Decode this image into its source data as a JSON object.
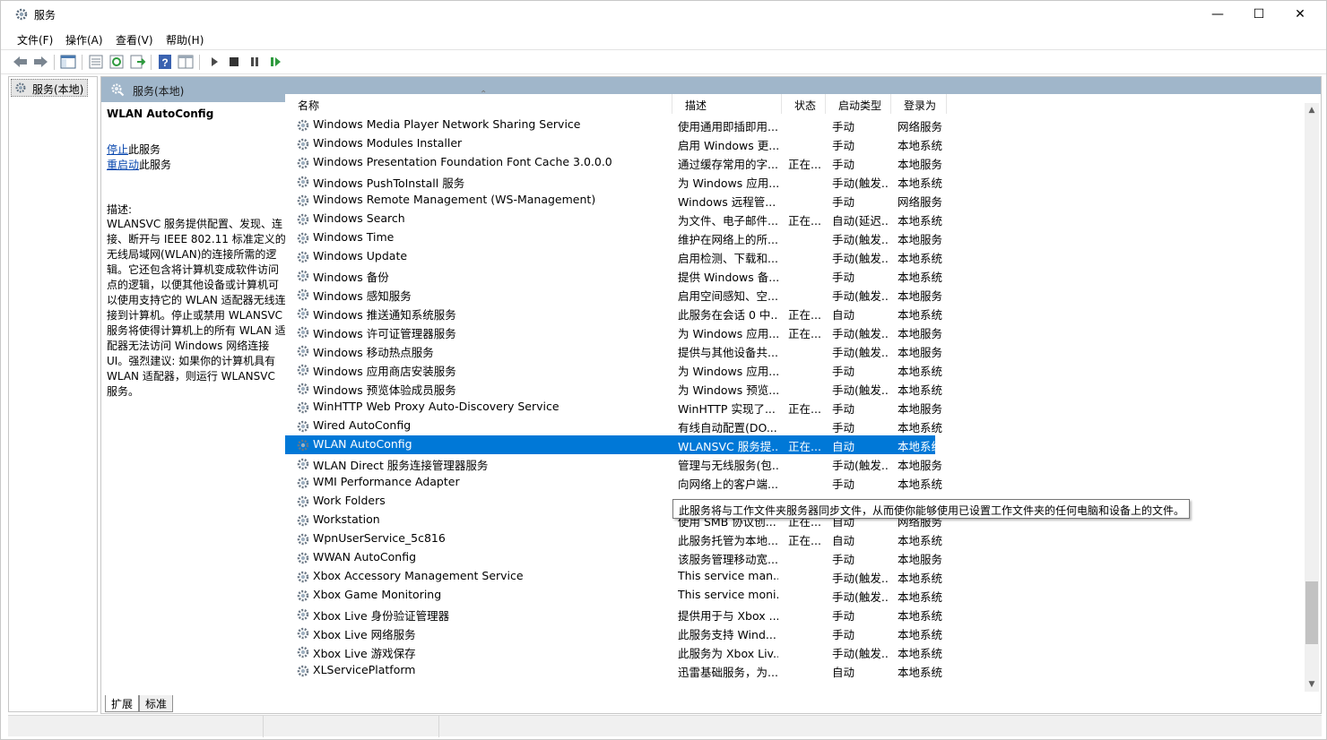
{
  "window": {
    "title": "服务",
    "minimize_label": "—",
    "maximize_label": "☐",
    "close_label": "✕"
  },
  "menu": {
    "items": [
      {
        "label": "文件(F)"
      },
      {
        "label": "操作(A)"
      },
      {
        "label": "查看(V)"
      },
      {
        "label": "帮助(H)"
      }
    ]
  },
  "toolbar": {
    "icons": [
      "back-icon",
      "forward-icon",
      "show-hide-tree-icon",
      "properties-icon",
      "refresh-icon",
      "export-list-icon",
      "help-icon",
      "show-pane-icon",
      "start-service-icon",
      "stop-service-icon",
      "pause-service-icon",
      "restart-service-icon"
    ]
  },
  "tree": {
    "selected_item": "服务(本地)"
  },
  "panel": {
    "header_title": "服务(本地)"
  },
  "description": {
    "service_name": "WLAN AutoConfig",
    "stop_link": "停止",
    "stop_suffix": "此服务",
    "restart_link": "重启动",
    "restart_suffix": "此服务",
    "label": "描述:",
    "text": "WLANSVC 服务提供配置、发现、连接、断开与 IEEE 802.11 标准定义的无线局域网(WLAN)的连接所需的逻辑。它还包含将计算机变成软件访问点的逻辑，以便其他设备或计算机可以使用支持它的 WLAN 适配器无线连接到计算机。停止或禁用 WLANSVC 服务将使得计算机上的所有 WLAN 适配器无法访问 Windows 网络连接 UI。强烈建议: 如果你的计算机具有 WLAN 适配器，则运行 WLANSVC 服务。"
  },
  "columns": {
    "name": "名称",
    "desc": "描述",
    "status": "状态",
    "startup": "启动类型",
    "logon": "登录为"
  },
  "services": [
    {
      "name": "Windows Media Player Network Sharing Service",
      "desc": "使用通用即插即用...",
      "status": "",
      "startup": "手动",
      "logon": "网络服务"
    },
    {
      "name": "Windows Modules Installer",
      "desc": "启用 Windows 更...",
      "status": "",
      "startup": "手动",
      "logon": "本地系统"
    },
    {
      "name": "Windows Presentation Foundation Font Cache 3.0.0.0",
      "desc": "通过缓存常用的字...",
      "status": "正在...",
      "startup": "手动",
      "logon": "本地服务"
    },
    {
      "name": "Windows PushToInstall 服务",
      "desc": "为 Windows 应用...",
      "status": "",
      "startup": "手动(触发...",
      "logon": "本地系统"
    },
    {
      "name": "Windows Remote Management (WS-Management)",
      "desc": "Windows 远程管...",
      "status": "",
      "startup": "手动",
      "logon": "网络服务"
    },
    {
      "name": "Windows Search",
      "desc": "为文件、电子邮件...",
      "status": "正在...",
      "startup": "自动(延迟...",
      "logon": "本地系统"
    },
    {
      "name": "Windows Time",
      "desc": "维护在网络上的所...",
      "status": "",
      "startup": "手动(触发...",
      "logon": "本地服务"
    },
    {
      "name": "Windows Update",
      "desc": "启用检测、下载和...",
      "status": "",
      "startup": "手动(触发...",
      "logon": "本地系统"
    },
    {
      "name": "Windows 备份",
      "desc": "提供 Windows 备...",
      "status": "",
      "startup": "手动",
      "logon": "本地系统"
    },
    {
      "name": "Windows 感知服务",
      "desc": "启用空间感知、空...",
      "status": "",
      "startup": "手动(触发...",
      "logon": "本地服务"
    },
    {
      "name": "Windows 推送通知系统服务",
      "desc": "此服务在会话 0 中...",
      "status": "正在...",
      "startup": "自动",
      "logon": "本地系统"
    },
    {
      "name": "Windows 许可证管理器服务",
      "desc": "为 Windows 应用...",
      "status": "正在...",
      "startup": "手动(触发...",
      "logon": "本地服务"
    },
    {
      "name": "Windows 移动热点服务",
      "desc": "提供与其他设备共...",
      "status": "",
      "startup": "手动(触发...",
      "logon": "本地服务"
    },
    {
      "name": "Windows 应用商店安装服务",
      "desc": "为 Windows 应用...",
      "status": "",
      "startup": "手动",
      "logon": "本地系统"
    },
    {
      "name": "Windows 预览体验成员服务",
      "desc": "为 Windows 预览...",
      "status": "",
      "startup": "手动(触发...",
      "logon": "本地系统"
    },
    {
      "name": "WinHTTP Web Proxy Auto-Discovery Service",
      "desc": "WinHTTP 实现了...",
      "status": "正在...",
      "startup": "手动",
      "logon": "本地服务"
    },
    {
      "name": "Wired AutoConfig",
      "desc": "有线自动配置(DO...",
      "status": "",
      "startup": "手动",
      "logon": "本地系统"
    },
    {
      "name": "WLAN AutoConfig",
      "desc": "WLANSVC 服务提...",
      "status": "正在...",
      "startup": "自动",
      "logon": "本地系统",
      "selected": true
    },
    {
      "name": "WLAN Direct 服务连接管理器服务",
      "desc": "管理与无线服务(包...",
      "status": "",
      "startup": "手动(触发...",
      "logon": "本地服务"
    },
    {
      "name": "WMI Performance Adapter",
      "desc": "向网络上的客户端...",
      "status": "",
      "startup": "手动",
      "logon": "本地系统"
    },
    {
      "name": "Work Folders",
      "desc": "",
      "status": "",
      "startup": "",
      "logon": ""
    },
    {
      "name": "Workstation",
      "desc": "使用 SMB 协议创...",
      "status": "正在...",
      "startup": "自动",
      "logon": "网络服务"
    },
    {
      "name": "WpnUserService_5c816",
      "desc": "此服务托管为本地...",
      "status": "正在...",
      "startup": "自动",
      "logon": "本地系统"
    },
    {
      "name": "WWAN AutoConfig",
      "desc": "该服务管理移动宽...",
      "status": "",
      "startup": "手动",
      "logon": "本地服务"
    },
    {
      "name": "Xbox Accessory Management Service",
      "desc": "This service man...",
      "status": "",
      "startup": "手动(触发...",
      "logon": "本地系统"
    },
    {
      "name": "Xbox Game Monitoring",
      "desc": "This service moni...",
      "status": "",
      "startup": "手动(触发...",
      "logon": "本地系统"
    },
    {
      "name": "Xbox Live 身份验证管理器",
      "desc": "提供用于与 Xbox ...",
      "status": "",
      "startup": "手动",
      "logon": "本地系统"
    },
    {
      "name": "Xbox Live 网络服务",
      "desc": "此服务支持 Wind...",
      "status": "",
      "startup": "手动",
      "logon": "本地系统"
    },
    {
      "name": "Xbox Live 游戏保存",
      "desc": "此服务为 Xbox Liv...",
      "status": "",
      "startup": "手动(触发...",
      "logon": "本地系统"
    },
    {
      "name": "XLServicePlatform",
      "desc": "迅雷基础服务，为...",
      "status": "",
      "startup": "自动",
      "logon": "本地系统"
    }
  ],
  "tooltip": {
    "text": "此服务将与工作文件夹服务器同步文件，从而使你能够使用已设置工作文件夹的任何电脑和设备上的文件。"
  },
  "tabs": [
    {
      "label": "扩展"
    },
    {
      "label": "标准"
    }
  ],
  "colors": {
    "panel_header": "#a0b6ca",
    "selection": "#0078d7"
  }
}
